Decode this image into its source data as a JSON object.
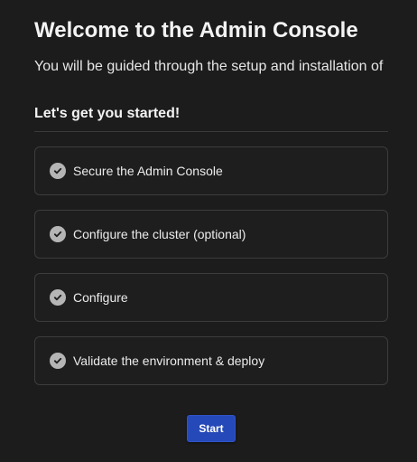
{
  "header": {
    "title": "Welcome to the Admin Console",
    "subtitle": "You will be guided through the setup and installation of"
  },
  "section": {
    "heading": "Let's get you started!"
  },
  "steps": [
    {
      "label": "Secure the Admin Console",
      "icon": "check-circle-icon"
    },
    {
      "label": "Configure the cluster (optional)",
      "icon": "check-circle-icon"
    },
    {
      "label": "Configure",
      "icon": "check-circle-icon"
    },
    {
      "label": "Validate the environment & deploy",
      "icon": "check-circle-icon"
    }
  ],
  "actions": {
    "start_label": "Start"
  },
  "colors": {
    "background": "#1c1c1c",
    "primary_button": "#2549b8",
    "check_icon": "#b5b5b5"
  }
}
